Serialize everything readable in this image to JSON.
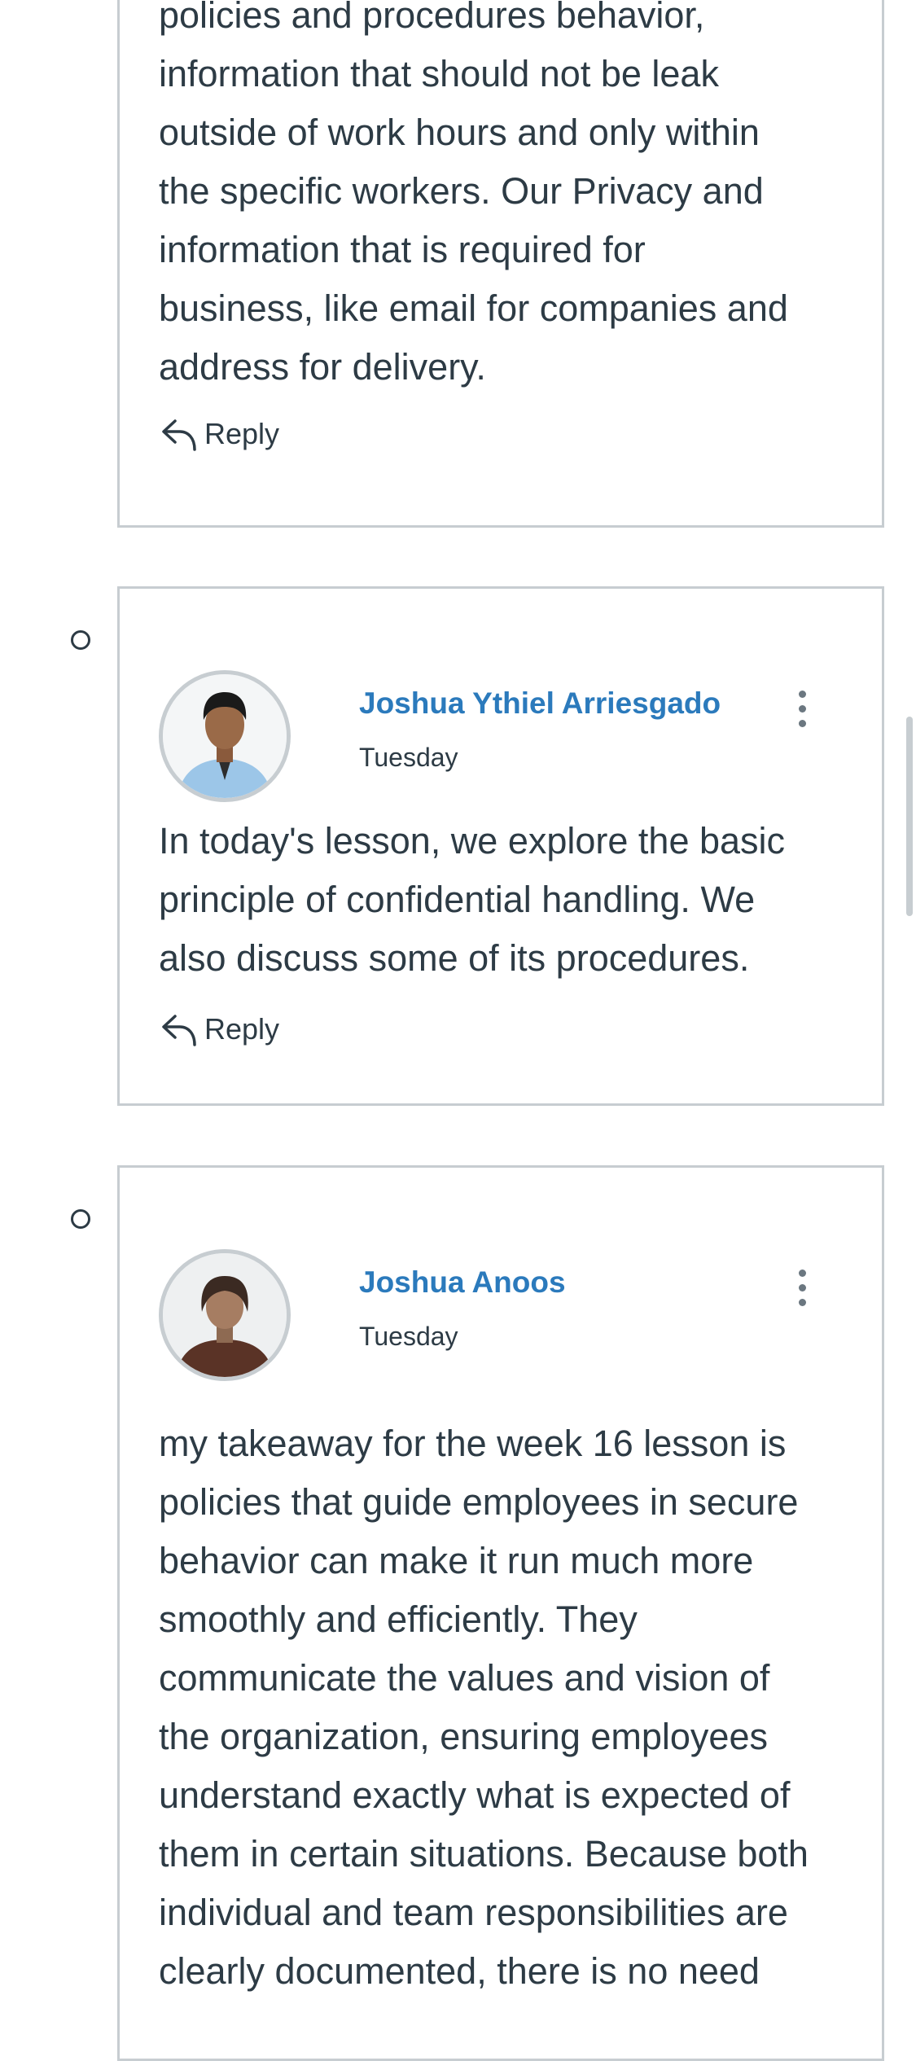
{
  "entries": [
    {
      "body": "policies and procedures behavior,\ninformation that should not be leak\noutside of work hours and only within\nthe specific workers. Our Privacy and\ninformation that is required for\nbusiness, like email for companies and\naddress for delivery.",
      "reply_label": "Reply"
    },
    {
      "author": "Joshua Ythiel Arriesgado",
      "date": "Tuesday",
      "body": "In today's lesson, we explore the basic\nprinciple of confidential handling. We\nalso discuss some of its procedures.",
      "reply_label": "Reply"
    },
    {
      "author": "Joshua Anoos",
      "date": "Tuesday",
      "body": "my takeaway for the week 16 lesson is\npolicies that guide employees in secure\nbehavior can make it run much more\nsmoothly and efficiently. They\ncommunicate the values and vision of\nthe organization, ensuring employees\nunderstand exactly what is expected of\nthem in certain situations. Because both\nindividual and team responsibilities are\nclearly documented, there is no need"
    }
  ],
  "icons": {
    "reply": "reply-arrow-icon",
    "more": "kebab-menu-icon",
    "unread": "unread-indicator-icon"
  },
  "colors": {
    "author_link": "#2b7abc",
    "text": "#2d3b45",
    "border": "#c7cdd1"
  }
}
